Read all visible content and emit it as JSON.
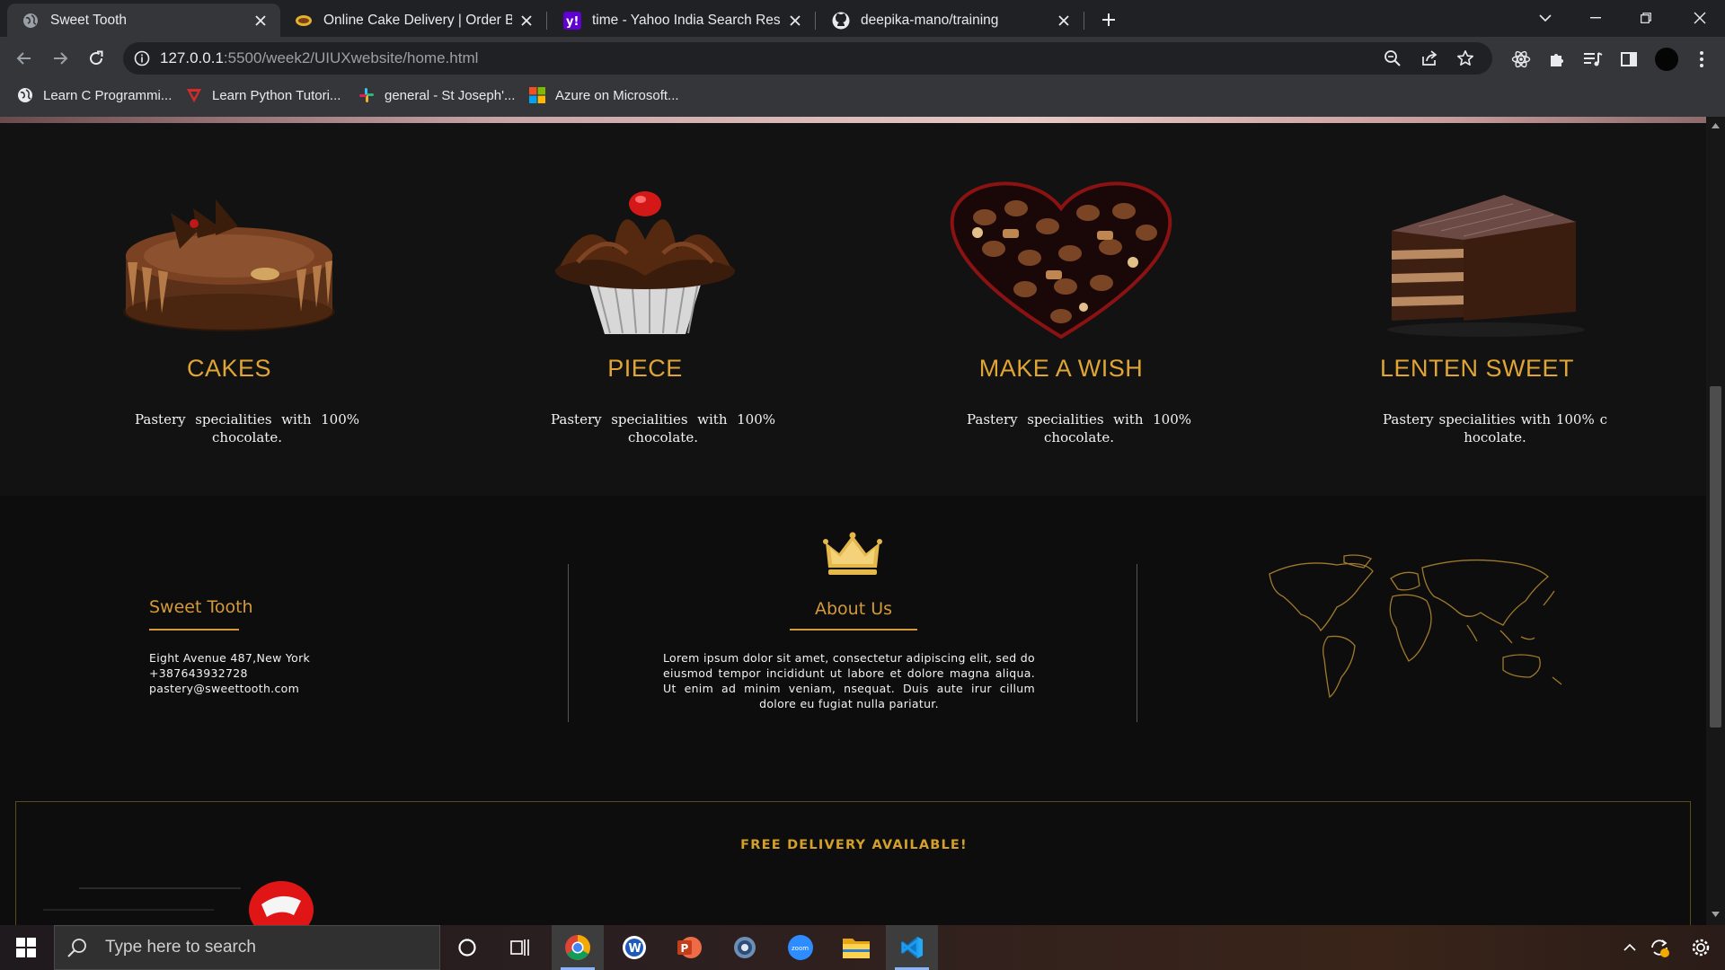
{
  "browser": {
    "tabs": [
      {
        "title": "Sweet Tooth",
        "active": true,
        "icon": "globe-icon"
      },
      {
        "title": "Online Cake Delivery | Order Best",
        "active": false,
        "icon": "cake-favicon-icon"
      },
      {
        "title": "time - Yahoo India Search Results",
        "active": false,
        "icon": "yahoo-icon"
      },
      {
        "title": "deepika-mano/training",
        "active": false,
        "icon": "github-icon"
      }
    ],
    "url": {
      "host": "127.0.0.1",
      "rest": ":5500/week2/UIUXwebsite/home.html"
    },
    "bookmarks": [
      {
        "label": "Learn C Programmi...",
        "icon": "globe-icon"
      },
      {
        "label": "Learn Python Tutori...",
        "icon": "python-tutor-icon"
      },
      {
        "label": "general - St Joseph'...",
        "icon": "slack-icon"
      },
      {
        "label": "Azure on Microsoft...",
        "icon": "microsoft-icon"
      }
    ]
  },
  "products": [
    {
      "title": "CAKES",
      "desc": "Pastery specialities with 100% chocolate."
    },
    {
      "title": "PIECE",
      "desc": "Pastery specialities with 100% chocolate."
    },
    {
      "title": "MAKE A WISH",
      "desc": "Pastery specialities with 100% chocolate."
    },
    {
      "title": "LENTEN SWEET",
      "desc": "Pastery specialities with 100% c hocolate."
    }
  ],
  "footer": {
    "brand": "Sweet Tooth",
    "address_lines": [
      "Eight Avenue 487,New York",
      "+387643932728",
      "pastery@sweettooth.com"
    ],
    "about_title": "About Us",
    "about_text": "Lorem ipsum dolor sit amet, consectetur adipiscing elit, sed do eiusmod tempor incididunt ut labore et dolore magna aliqua. Ut enim ad minim veniam, nsequat. Duis aute irur cillum dolore eu fugiat nulla pariatur."
  },
  "delivery": {
    "banner": "FREE DELIVERY AVAILABLE!"
  },
  "taskbar": {
    "search_placeholder": "Type here to search"
  },
  "colors": {
    "accent_gold": "#e0a534",
    "page_bg": "#0d0d0d",
    "chrome_bg": "#202124"
  }
}
